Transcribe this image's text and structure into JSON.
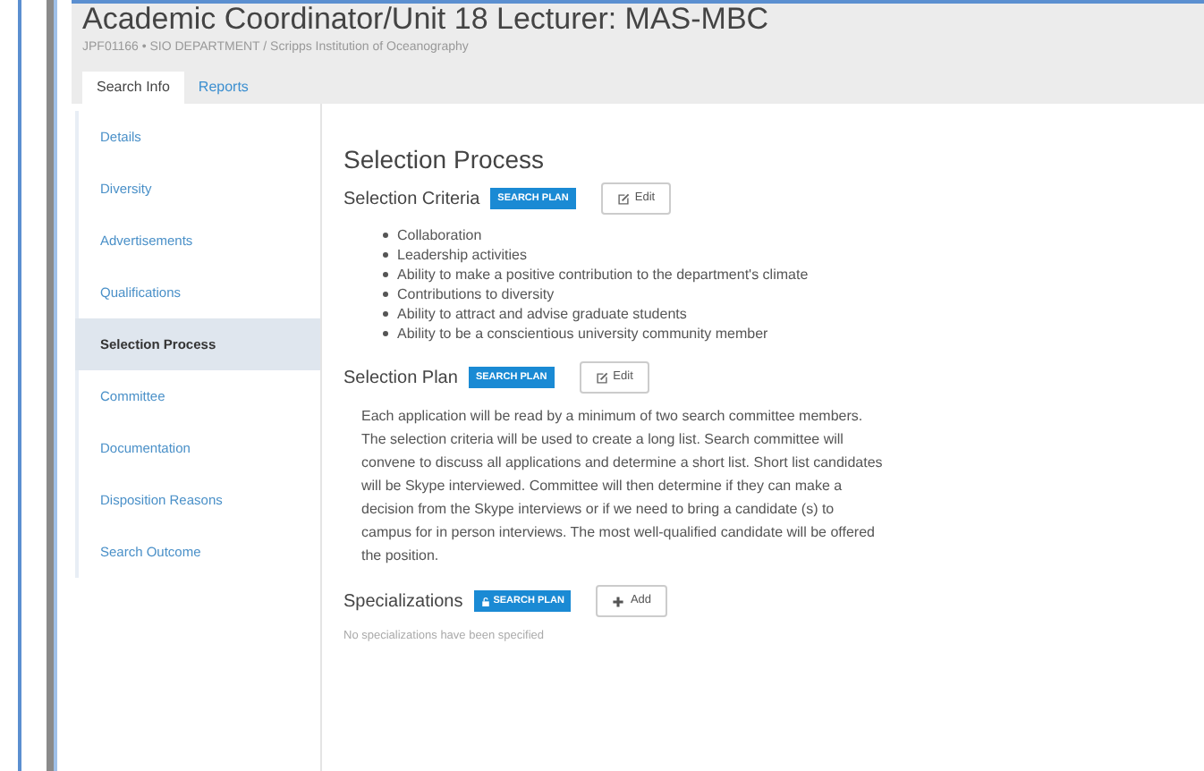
{
  "header": {
    "title": "Academic Coordinator/Unit 18 Lecturer: MAS-MBC",
    "subtitle": "JPF01166 • SIO DEPARTMENT / Scripps Institution of Oceanography"
  },
  "tabs": [
    {
      "label": "Search Info",
      "selected": true
    },
    {
      "label": "Reports",
      "selected": false
    }
  ],
  "sidebar": {
    "items": [
      {
        "label": "Details",
        "selected": false
      },
      {
        "label": "Diversity",
        "selected": false
      },
      {
        "label": "Advertisements",
        "selected": false
      },
      {
        "label": "Qualifications",
        "selected": false
      },
      {
        "label": "Selection Process",
        "selected": true
      },
      {
        "label": "Committee",
        "selected": false
      },
      {
        "label": "Documentation",
        "selected": false
      },
      {
        "label": "Disposition Reasons",
        "selected": false
      },
      {
        "label": "Search Outcome",
        "selected": false
      }
    ]
  },
  "main": {
    "title": "Selection Process",
    "sections": [
      {
        "kind": "list",
        "title": "Selection Criteria",
        "badge": "SEARCH PLAN",
        "badge_locked": false,
        "button": {
          "label": "Edit",
          "kind": "edit"
        },
        "items": [
          "Collaboration",
          "Leadership activities",
          "Ability to make a positive contribution to the department's climate",
          "Contributions to diversity",
          "Ability to attract and advise graduate students",
          "Ability to be a conscientious university community member"
        ]
      },
      {
        "kind": "text",
        "title": "Selection Plan",
        "badge": "SEARCH PLAN",
        "badge_locked": false,
        "button": {
          "label": "Edit",
          "kind": "edit"
        },
        "text": "Each application will be read by a minimum of two search committee members. The selection criteria will be used to create a long list. Search committee will convene to discuss all applications and determine a short list. Short list candidates will be Skype interviewed. Committee will then determine if they can make a decision from the Skype interviews or if we need to bring a candidate (s) to campus for in person interviews. The most well-qualified candidate will be offered the position."
      },
      {
        "kind": "empty",
        "title": "Specializations",
        "badge": "SEARCH PLAN",
        "badge_locked": true,
        "button": {
          "label": "Add",
          "kind": "add"
        },
        "text": "No specializations have been specified"
      }
    ]
  }
}
